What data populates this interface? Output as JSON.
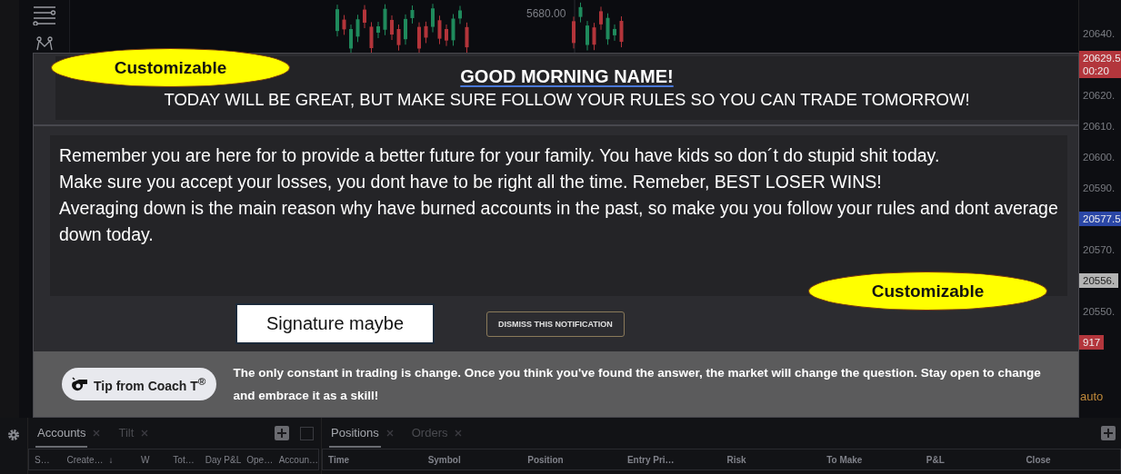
{
  "chart": {
    "price_label": "5680.00"
  },
  "price_axis": {
    "items": [
      {
        "kind": "tick",
        "text": "20640."
      },
      {
        "kind": "badge",
        "text": "20629.5",
        "sub": "00:20",
        "color": "#b3363c"
      },
      {
        "kind": "tick",
        "text": "20620."
      },
      {
        "kind": "tick",
        "text": "20610."
      },
      {
        "kind": "tick",
        "text": "20600."
      },
      {
        "kind": "tick",
        "text": "20590."
      },
      {
        "kind": "badge",
        "text": "20577.5",
        "color": "#2b47a6"
      },
      {
        "kind": "tick",
        "text": "20570."
      },
      {
        "kind": "badge",
        "text": "20556.",
        "color": "#b4b4b4"
      },
      {
        "kind": "tick",
        "text": "20550."
      },
      {
        "kind": "badge",
        "text": "917",
        "color": "#b3363c"
      }
    ],
    "scale_mode": "auto"
  },
  "notification": {
    "title": "GOOD MORNING NAME!",
    "subtitle": "TODAY WILL BE GREAT, BUT MAKE SURE FOLLOW YOUR RULES SO YOU CAN TRADE TOMORROW!",
    "message": [
      "Remember you are here for to provide a better future for your family. You have kids so don´t do stupid shit today.",
      "Make sure you accept your losses, you dont have to be right all the time. Remeber, BEST LOSER WINS!",
      "Averaging down is the main reason why have burned accounts in the past, so make you you follow your rules and dont average down today."
    ],
    "signature": "Signature maybe",
    "dismiss_button": "DISMISS THIS NOTIFICATION",
    "tip": {
      "badge": "Tip from Coach T$^{®}$",
      "text": "The only constant in trading is change. Once you think you've found the answer, the market will change the question. Stay open to change and embrace it as a skill!"
    }
  },
  "annotations": [
    {
      "text": "Customizable"
    },
    {
      "text": "Customizable"
    }
  ],
  "accounts_panel": {
    "tabs": [
      {
        "label": "Accounts",
        "selected": true
      },
      {
        "label": "Tilt",
        "selected": false
      }
    ],
    "columns": [
      "S…",
      "Create…",
      "↓",
      "W",
      "Tot…",
      "Day P&L",
      "Ope…",
      "Accoun…"
    ]
  },
  "positions_panel": {
    "tabs": [
      {
        "label": "Positions",
        "selected": true
      },
      {
        "label": "Orders",
        "selected": false
      }
    ],
    "columns": [
      "Time",
      "Symbol",
      "Position",
      "Entry Pri…",
      "Risk",
      "To Make",
      "P&L",
      "Close"
    ]
  }
}
